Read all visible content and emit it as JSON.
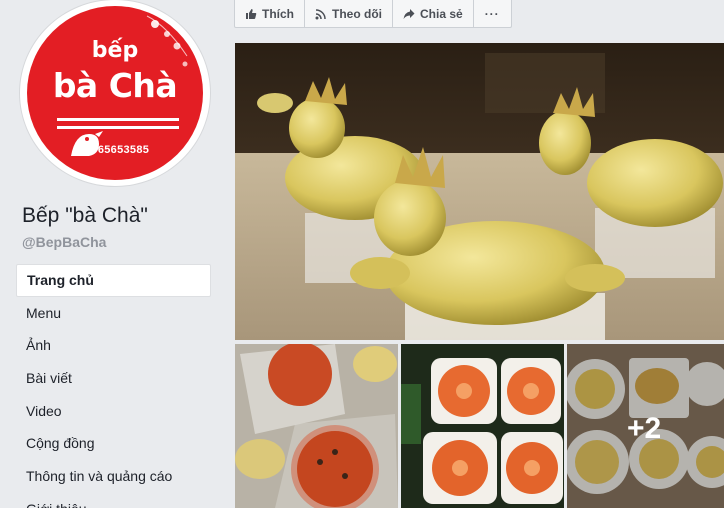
{
  "profile": {
    "logo_line1": "bếp",
    "logo_line2": "bà Chà",
    "logo_phone": "0965653585",
    "page_name": "Bếp \"bà Chà\"",
    "handle": "@BepBaCha"
  },
  "nav": {
    "items": [
      {
        "label": "Trang chủ",
        "active": true
      },
      {
        "label": "Menu"
      },
      {
        "label": "Ảnh"
      },
      {
        "label": "Bài viết"
      },
      {
        "label": "Video"
      },
      {
        "label": "Cộng đồng"
      },
      {
        "label": "Thông tin và quảng cáo"
      },
      {
        "label": "Giới thiệu"
      }
    ]
  },
  "actions": {
    "like": "Thích",
    "follow": "Theo dõi",
    "share": "Chia sẻ",
    "more": "···"
  },
  "photos": {
    "more_count": "+2"
  },
  "colors": {
    "brand_red": "#e31e24",
    "fb_bg": "#e9ebee",
    "text_dark": "#1d2129",
    "text_muted": "#90949c"
  },
  "icons": [
    "thumbs-up-icon",
    "rss-icon",
    "share-arrow-icon",
    "ellipsis-icon"
  ]
}
